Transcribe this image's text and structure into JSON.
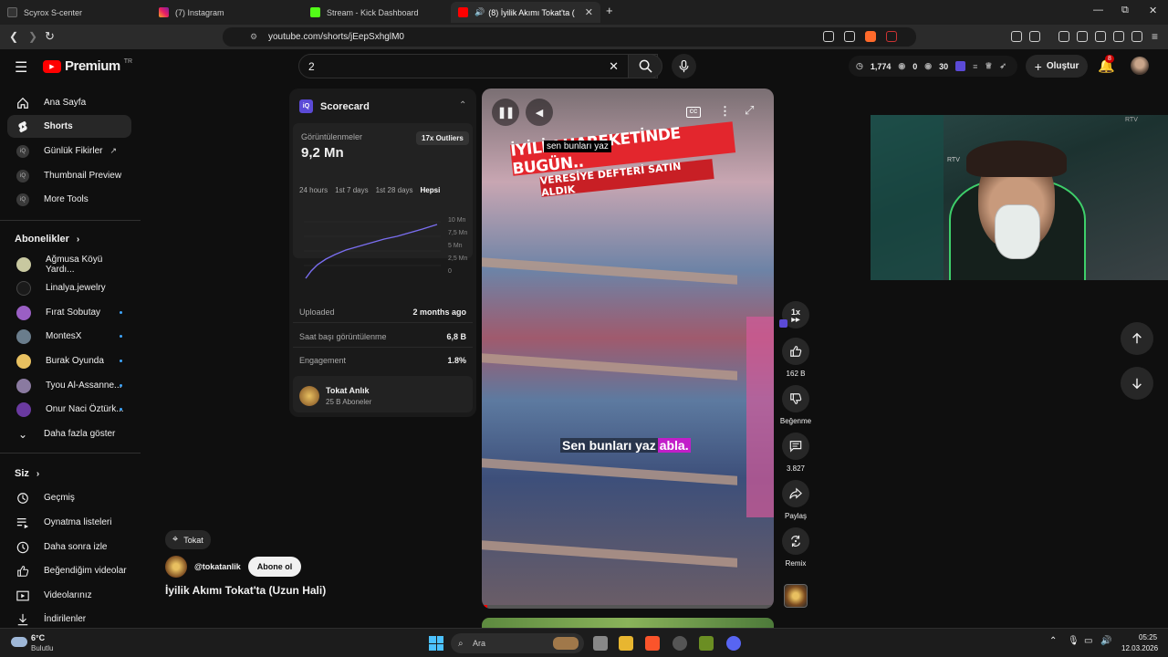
{
  "browser": {
    "tabs": [
      {
        "title": "Scyrox S-center",
        "active": false
      },
      {
        "title": "(7) Instagram",
        "active": false
      },
      {
        "title": "Stream - Kick Dashboard",
        "active": false
      },
      {
        "title": "(8) İyilik Akımı Tokat'ta (Uzun",
        "active": true
      }
    ],
    "new_tab": "+",
    "url": "youtube.com/shorts/jEepSxhglM0",
    "window_controls": {
      "minimize": "—",
      "maximize": "⧉",
      "close": "✕"
    }
  },
  "header": {
    "logo_text": "Premium",
    "logo_region": "TR",
    "search_value": "2",
    "stats": {
      "clock": "1,774",
      "v1": "0",
      "v2": "30"
    },
    "create_label": "Oluştur",
    "notification_count": "8"
  },
  "sidebar": {
    "main": [
      {
        "label": "Ana Sayfa",
        "icon": "home-icon"
      },
      {
        "label": "Shorts",
        "icon": "shorts-icon",
        "active": true
      },
      {
        "label": "Günlük Fikirler",
        "icon": "vidiq-icon",
        "external": true
      },
      {
        "label": "Thumbnail Preview",
        "icon": "vidiq-icon"
      },
      {
        "label": "More Tools",
        "icon": "vidiq-icon"
      }
    ],
    "subs_title": "Abonelikler",
    "subs": [
      {
        "label": "Ağmusa Köyü Yardı...",
        "color": "#c8c8a0",
        "dot": false
      },
      {
        "label": "Linalya.jewelry",
        "color": "#1a1a1a",
        "dot": false
      },
      {
        "label": "Fırat Sobutay",
        "color": "#9a5fc4",
        "dot": true
      },
      {
        "label": "MontesX",
        "color": "#6a7d8c",
        "dot": true
      },
      {
        "label": "Burak Oyunda",
        "color": "#e8c060",
        "dot": true
      },
      {
        "label": "Tyou Al-Assanne...",
        "color": "#8a7aa0",
        "dot": true
      },
      {
        "label": "Onur Naci Öztürk...",
        "color": "#6a3aa0",
        "dot": true
      }
    ],
    "show_more": "Daha fazla göster",
    "you_title": "Siz",
    "you": [
      {
        "label": "Geçmiş",
        "icon": "history-icon"
      },
      {
        "label": "Oynatma listeleri",
        "icon": "playlist-icon"
      },
      {
        "label": "Daha sonra izle",
        "icon": "clock-icon"
      },
      {
        "label": "Beğendiğim videolar",
        "icon": "like-icon"
      },
      {
        "label": "Videolarınız",
        "icon": "video-icon"
      },
      {
        "label": "İndirilenler",
        "icon": "download-icon"
      }
    ]
  },
  "scorecard": {
    "title": "Scorecard",
    "views_label": "Görüntülenmeler",
    "views_value": "9,2 Mn",
    "outlier": "17x Outliers",
    "ranges": [
      "24 hours",
      "1st 7 days",
      "1st 28 days",
      "Hepsi"
    ],
    "y_ticks": [
      "10 Mn",
      "7,5 Mn",
      "5 Mn",
      "2,5 Mn",
      "0"
    ],
    "rows": [
      {
        "label": "Uploaded",
        "value": "2 months ago"
      },
      {
        "label": "Saat başı görüntülenme",
        "value": "6,8 B"
      },
      {
        "label": "Engagement",
        "value": "1.8%"
      }
    ],
    "channel_name": "Tokat Anlık",
    "channel_subs": "25 B Aboneler"
  },
  "video": {
    "top_caption": "sen bunları yaz",
    "banner_line1": "İYİLİK HAREKETİNDE BUGÜN..",
    "banner_line2": "VERESİYE DEFTERİ SATIN ALDIK",
    "subtitle_plain": "Sen bunları yaz",
    "subtitle_highlight": "abla.",
    "cc_label": "CC",
    "progress": 0.02
  },
  "actions": {
    "speed": "1x",
    "likes": "162 B",
    "dislike": "Beğenme",
    "comments": "3.827",
    "share": "Paylaş",
    "remix": "Remix"
  },
  "meta": {
    "location": "Tokat",
    "channel_handle": "@tokatanlik",
    "subscribe": "Abone ol",
    "title": "İyilik Akımı Tokat'ta (Uzun Hali)"
  },
  "webcam": {
    "sign": "RTV"
  },
  "taskbar": {
    "weather_temp": "6°C",
    "weather_desc": "Bulutlu",
    "search_placeholder": "Ara",
    "time": "05:25",
    "date": "12.03.2026"
  },
  "colors": {
    "accent": "#ff0000",
    "link": "#3ea6ff",
    "vidiq": "#5b4ad6",
    "subtitle_hl": "#c21ec9"
  }
}
